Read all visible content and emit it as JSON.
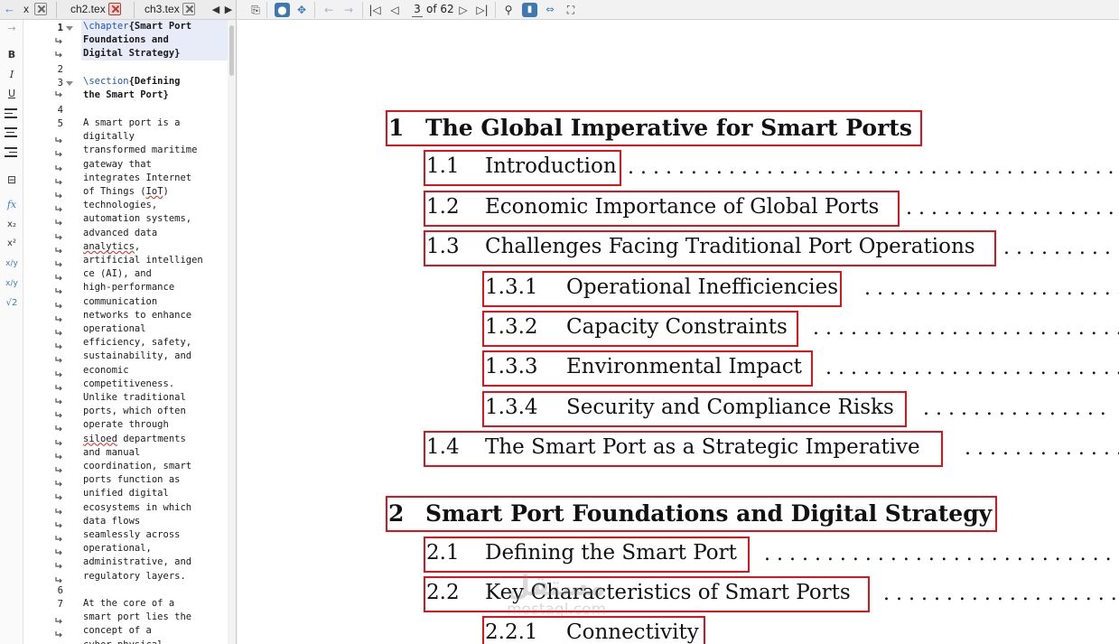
{
  "editor": {
    "tabs": [
      {
        "label": "x"
      },
      {
        "label": "ch2.tex"
      },
      {
        "label": "ch3.tex"
      }
    ],
    "line_numbers": [
      "1",
      "2",
      "3",
      "4",
      "5",
      "6",
      "7"
    ],
    "code": {
      "l1a": "\\chapter",
      "l1b": "{Smart Port",
      "l1c": "Foundations and",
      "l1d": "Digital Strategy}",
      "l3a": "\\section",
      "l3b": "{Defining",
      "l3c": "the Smart Port}",
      "para1": [
        "A smart port is a",
        "digitally",
        "transformed maritime",
        "gateway that",
        "integrates Internet",
        "of Things (IoT)",
        "technologies,",
        "automation systems,",
        "advanced data",
        "analytics,",
        "artificial intelligen",
        "ce (AI), and",
        "high-performance",
        "communication",
        "networks to enhance",
        "operational",
        "efficiency, safety,",
        "sustainability, and",
        "economic",
        "competitiveness.",
        "Unlike traditional",
        "ports, which often",
        "operate through",
        "siloed departments",
        "and manual",
        "coordination, smart",
        "ports function as",
        "unified digital",
        "ecosystems in which",
        "data flows",
        "seamlessly across",
        "operational,",
        "administrative, and",
        "regulatory layers."
      ],
      "para2": [
        "At the core of a",
        "smart port lies the",
        "concept of a",
        "cyber-physical"
      ]
    }
  },
  "viewer": {
    "page_current": "3",
    "page_total_text": "of 62",
    "toc": [
      {
        "num": "1",
        "title": "The Global Imperative for Smart Ports",
        "level": "chapter"
      },
      {
        "num": "1.1",
        "title": "Introduction",
        "level": "section"
      },
      {
        "num": "1.2",
        "title": "Economic Importance of Global Ports",
        "level": "section"
      },
      {
        "num": "1.3",
        "title": "Challenges Facing Traditional Port Operations",
        "level": "section"
      },
      {
        "num": "1.3.1",
        "title": "Operational Inefficiencies",
        "level": "subsection"
      },
      {
        "num": "1.3.2",
        "title": "Capacity Constraints",
        "level": "subsection"
      },
      {
        "num": "1.3.3",
        "title": "Environmental Impact",
        "level": "subsection"
      },
      {
        "num": "1.3.4",
        "title": "Security and Compliance Risks",
        "level": "subsection"
      },
      {
        "num": "1.4",
        "title": "The Smart Port as a Strategic Imperative",
        "level": "section"
      },
      {
        "num": "2",
        "title": "Smart Port Foundations and Digital Strategy",
        "level": "chapter"
      },
      {
        "num": "2.1",
        "title": "Defining the Smart Port",
        "level": "section"
      },
      {
        "num": "2.2",
        "title": "Key Characteristics of Smart Ports",
        "level": "section"
      },
      {
        "num": "2.2.1",
        "title": "Connectivity",
        "level": "subsection"
      }
    ],
    "watermark_big": "مستقل",
    "watermark_small": "mostaql.com"
  },
  "colors": {
    "highlight_box": "#e0121b",
    "keyword": "#1c55c7",
    "toolbar_accent": "#3c79b3"
  }
}
